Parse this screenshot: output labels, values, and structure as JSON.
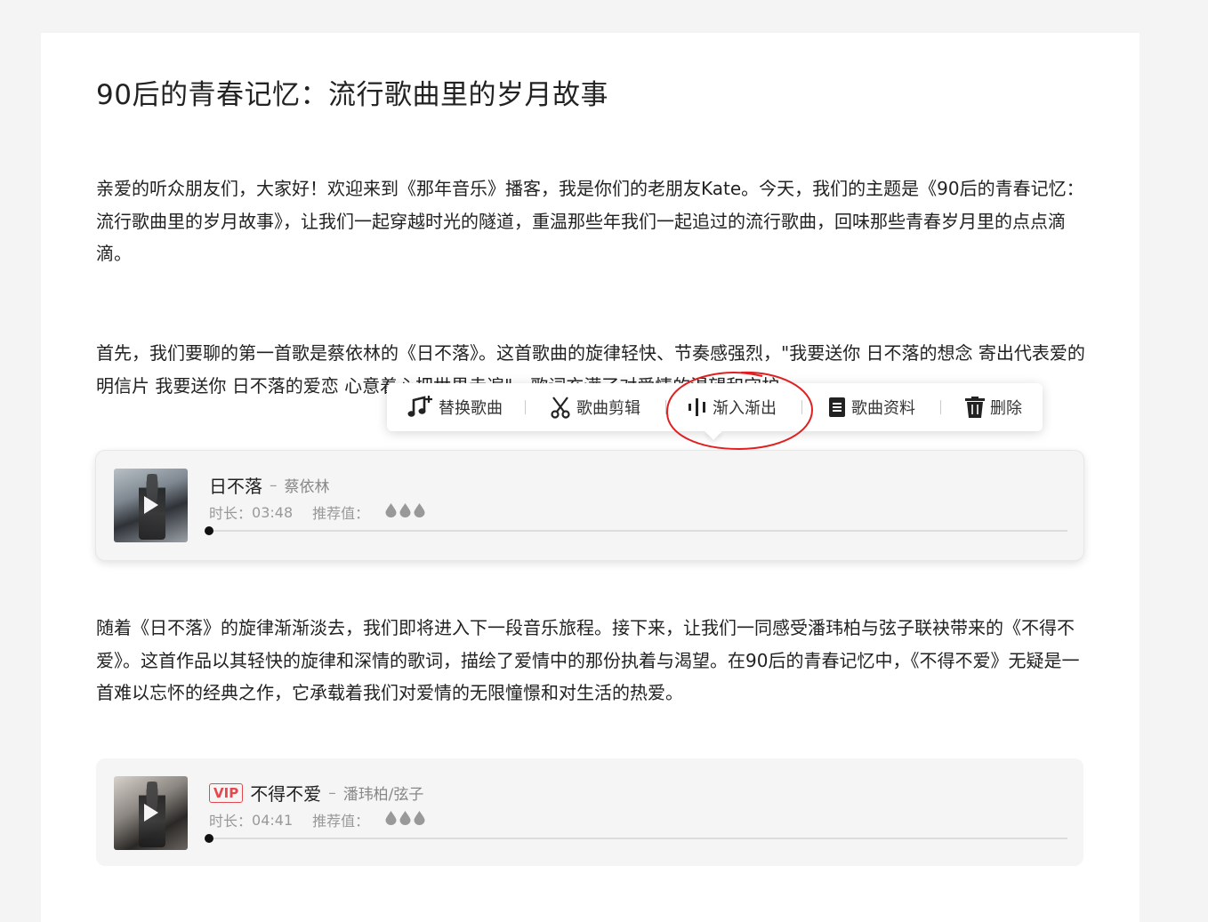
{
  "article": {
    "title": "90后的青春记忆：流行歌曲里的岁月故事",
    "paragraphs": [
      "亲爱的听众朋友们，大家好！欢迎来到《那年音乐》播客，我是你们的老朋友Kate。今天，我们的主题是《90后的青春记忆：流行歌曲里的岁月故事》，让我们一起穿越时光的隧道，重温那些年我们一起追过的流行歌曲，回味那些青春岁月里的点点滴滴。",
      "首先，我们要聊的第一首歌是蔡依林的《日不落》。这首歌曲的旋律轻快、节奏感强烈，\"我要送你 日不落的想念 寄出代表爱的明信片 我要送你 日不落的爱恋 心意着心把世界走遍\"，歌词充满了对爱情的渴望和守护。",
      "随着《日不落》的旋律渐渐淡去，我们即将进入下一段音乐旅程。接下来，让我们一同感受潘玮柏与弦子联袂带来的《不得不爱》。这首作品以其轻快的旋律和深情的歌词，描绘了爱情中的那份执着与渴望。在90后的青春记忆中，《不得不爱》无疑是一首难以忘怀的经典之作，它承载着我们对爱情的无限憧憬和对生活的热爱。"
    ]
  },
  "toolbar": {
    "items": [
      {
        "label": "替换歌曲",
        "icon": "music-replace-icon"
      },
      {
        "label": "歌曲剪辑",
        "icon": "scissors-icon"
      },
      {
        "label": "渐入渐出",
        "icon": "fade-waveform-icon"
      },
      {
        "label": "歌曲资料",
        "icon": "document-icon"
      },
      {
        "label": "删除",
        "icon": "trash-icon"
      }
    ]
  },
  "songs": [
    {
      "title": "日不落",
      "dash": "–",
      "artist": "蔡依林",
      "vip": "",
      "duration_label": "时长：",
      "duration": "03:48",
      "recommend_label": "推荐值：",
      "recommend_level": 3,
      "progress": 0
    },
    {
      "title": "不得不爱",
      "dash": "–",
      "artist": "潘玮柏/弦子",
      "vip": "VIP",
      "duration_label": "时长：",
      "duration": "04:41",
      "recommend_label": "推荐值：",
      "recommend_level": 3,
      "progress": 0
    }
  ],
  "colors": {
    "annotation_circle": "#e02020",
    "vip": "#e5484d",
    "drop": "#999999"
  }
}
